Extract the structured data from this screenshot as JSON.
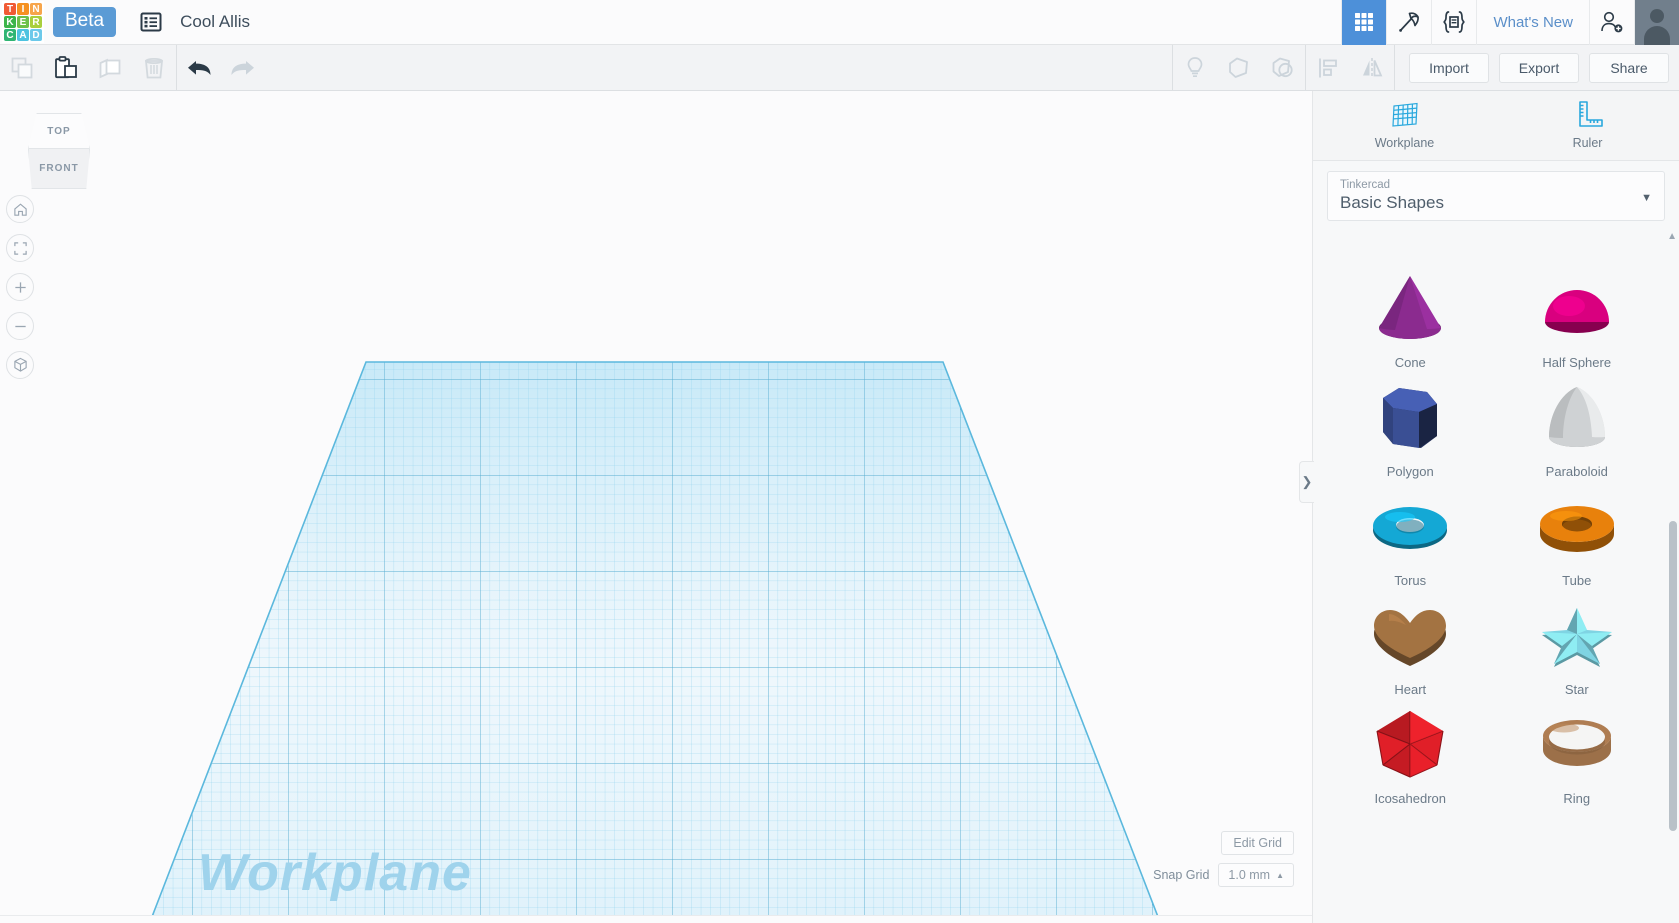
{
  "app": {
    "brand": "TINKERCAD",
    "beta_label": "Beta",
    "document_title": "Cool Allis",
    "logo_tiles": [
      {
        "letter": "T",
        "color": "#f05a35"
      },
      {
        "letter": "I",
        "color": "#f59120"
      },
      {
        "letter": "N",
        "color": "#f7a54b"
      },
      {
        "letter": "K",
        "color": "#3cb44a"
      },
      {
        "letter": "E",
        "color": "#6cc04a"
      },
      {
        "letter": "R",
        "color": "#a9cf3d"
      },
      {
        "letter": "C",
        "color": "#2fb573"
      },
      {
        "letter": "A",
        "color": "#4ec3e0"
      },
      {
        "letter": "D",
        "color": "#6cc9ea"
      }
    ]
  },
  "topbar": {
    "list_icon": "list-icon",
    "items": [
      {
        "name": "grid-apps-icon",
        "label": "3D Design",
        "active": true
      },
      {
        "name": "pickaxe-icon",
        "label": "Minecraft",
        "active": false
      },
      {
        "name": "codeblocks-icon",
        "label": "Codeblocks",
        "active": false
      }
    ],
    "whats_new": "What's New",
    "add_user_icon": "add-user-icon",
    "avatar": "avatar"
  },
  "toolbar": {
    "left_buttons": [
      {
        "name": "copy-button",
        "label": "Copy",
        "enabled": false
      },
      {
        "name": "paste-button",
        "label": "Paste",
        "enabled": true
      },
      {
        "name": "duplicate-button",
        "label": "Duplicate",
        "enabled": false
      },
      {
        "name": "delete-button",
        "label": "Delete",
        "enabled": false
      }
    ],
    "history_buttons": [
      {
        "name": "undo-button",
        "label": "Undo",
        "enabled": true
      },
      {
        "name": "redo-button",
        "label": "Redo",
        "enabled": false
      }
    ],
    "right_icons": [
      {
        "name": "lightbulb-icon",
        "label": "Notes",
        "enabled": false
      },
      {
        "name": "hide-shape-icon",
        "label": "Show/Hide",
        "enabled": false
      },
      {
        "name": "group-icon",
        "label": "Group",
        "enabled": false
      },
      {
        "name": "align-icon",
        "label": "Align",
        "enabled": false
      },
      {
        "name": "mirror-icon",
        "label": "Mirror",
        "enabled": false
      }
    ],
    "import_label": "Import",
    "export_label": "Export",
    "share_label": "Share"
  },
  "canvas": {
    "viewcube": {
      "top_face": "TOP",
      "front_face": "FRONT"
    },
    "nav_buttons": [
      {
        "name": "home-view-button",
        "icon": "home-icon"
      },
      {
        "name": "fit-to-view-button",
        "icon": "fit-frame-icon"
      },
      {
        "name": "zoom-in-button",
        "icon": "plus-icon"
      },
      {
        "name": "zoom-out-button",
        "icon": "minus-icon"
      },
      {
        "name": "projection-toggle-button",
        "icon": "cube-icon"
      }
    ],
    "workplane_label": "Workplane",
    "edit_grid_label": "Edit Grid",
    "snap_grid_label": "Snap Grid",
    "snap_grid_value": "1.0 mm",
    "snap_caret": "▲",
    "grid_color": "#6fc7e8",
    "grid_fill": "#dff1fa"
  },
  "rightpanel": {
    "tools": [
      {
        "name": "workplane-tool",
        "label": "Workplane",
        "icon": "workplane-icon"
      },
      {
        "name": "ruler-tool",
        "label": "Ruler",
        "icon": "ruler-icon"
      }
    ],
    "library_source": "Tinkercad",
    "library_name": "Basic Shapes",
    "caret": "▼",
    "collapse_chevron": "❯",
    "scroll_up_caret": "▲",
    "shapes": [
      {
        "name": "Cone",
        "icon": "cone-shape",
        "color": "#8b2b8f"
      },
      {
        "name": "Half Sphere",
        "icon": "half-sphere-shape",
        "color": "#d9007f"
      },
      {
        "name": "Polygon",
        "icon": "polygon-shape",
        "color": "#3a4f94"
      },
      {
        "name": "Paraboloid",
        "icon": "paraboloid-shape",
        "color": "#cfd2d4"
      },
      {
        "name": "Torus",
        "icon": "torus-shape",
        "color": "#14a8d5"
      },
      {
        "name": "Tube",
        "icon": "tube-shape",
        "color": "#e8810c"
      },
      {
        "name": "Heart",
        "icon": "heart-shape",
        "color": "#a37342"
      },
      {
        "name": "Star",
        "icon": "star-shape",
        "color": "#7fd4e3"
      },
      {
        "name": "Icosahedron",
        "icon": "icosahedron-shape",
        "color": "#e01f28"
      },
      {
        "name": "Ring",
        "icon": "ring-shape",
        "color": "#9c7049"
      }
    ]
  }
}
